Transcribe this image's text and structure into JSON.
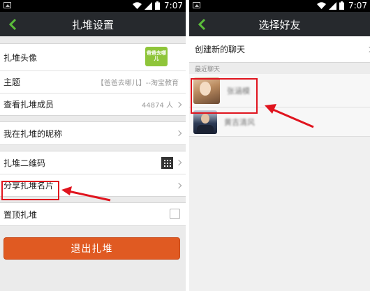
{
  "status_bar": {
    "time": "7:07"
  },
  "left_screen": {
    "title": "扎堆设置",
    "rows": {
      "avatar_label": "扎堆头像",
      "avatar_logo_text": "爸爸去哪儿",
      "topic_label": "主题",
      "topic_value": "【爸爸去哪儿】--淘宝教育",
      "members_label": "查看扎堆成员",
      "members_value": "44874 人",
      "nickname_label": "我在扎堆的昵称",
      "qr_label": "扎堆二维码",
      "share_label": "分享扎堆名片",
      "pin_label": "置顶扎堆"
    },
    "exit_button": "退出扎堆"
  },
  "right_screen": {
    "title": "选择好友",
    "new_chat": "创建新的聊天",
    "recent_header": "最近聊天",
    "contacts": [
      {
        "name": "张涵模"
      },
      {
        "name": "黄吉清风"
      }
    ]
  },
  "colors": {
    "titlebar": "#26292d",
    "back_arrow": "#5bbd3a",
    "exit_button": "#e05a22",
    "annotation_red": "#e0141e"
  },
  "icons": [
    "image-icon",
    "wifi-icon",
    "signal-icon",
    "battery-icon",
    "back-arrow-icon",
    "chevron-right-icon",
    "qr-code-icon",
    "checkbox-icon"
  ]
}
